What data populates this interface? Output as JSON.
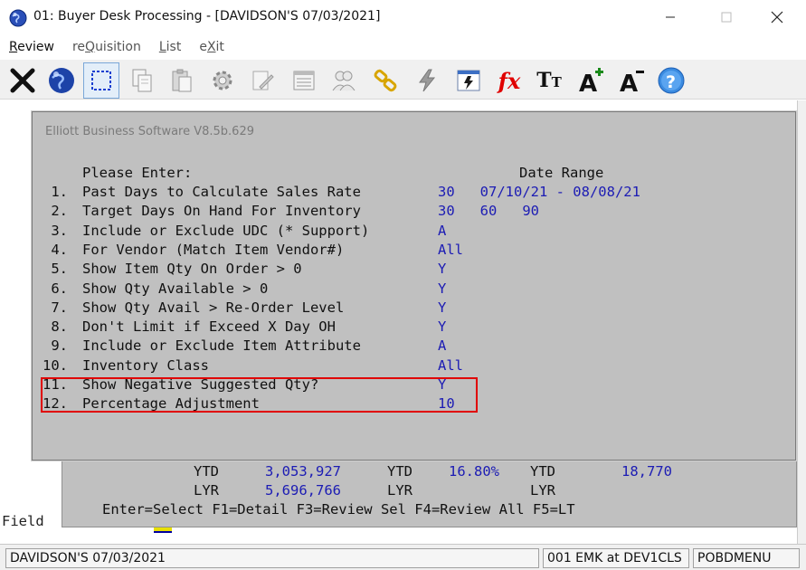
{
  "window": {
    "title": "01: Buyer Desk Processing - [DAVIDSON'S 07/03/2021]",
    "minimize_glyph": "—",
    "maximize_glyph": "☐",
    "close_glyph": "✕"
  },
  "menu": {
    "items": [
      {
        "label": "Review",
        "underline": "R",
        "rest": "eview"
      },
      {
        "label": "reQuisition",
        "pre": "re",
        "underline": "Q",
        "rest": "uisition"
      },
      {
        "label": "List",
        "underline": "L",
        "rest": "ist"
      },
      {
        "label": "eXit",
        "pre": "e",
        "underline": "X",
        "rest": "it"
      }
    ]
  },
  "toolbar": {
    "icons": [
      "close-x-icon",
      "globe-icon",
      "select-rect-icon",
      "copy-icon",
      "paste-icon",
      "settings-gear-icon",
      "edit-icon",
      "list-icon",
      "users-icon",
      "link-icon",
      "lightning-icon",
      "spreadsheet-icon",
      "fx-function-icon",
      "font-size-icon",
      "font-increase-icon",
      "font-decrease-icon",
      "help-icon"
    ],
    "fx_label": "fx",
    "help_label": "?"
  },
  "dialog": {
    "title": "Elliott Business Software V8.5b.629",
    "heading": "Please Enter:",
    "date_range_header": "Date Range",
    "rows": [
      {
        "num": " 1.",
        "label": "Past Days to Calculate Sales Rate",
        "value": "30   07/10/21 - 08/08/21"
      },
      {
        "num": " 2.",
        "label": "Target Days On Hand For Inventory",
        "value": "30   60   90"
      },
      {
        "num": " 3.",
        "label": "Include or Exclude UDC (* Support)",
        "value": "A"
      },
      {
        "num": " 4.",
        "label": "For Vendor (Match Item Vendor#)",
        "value": "All"
      },
      {
        "num": " 5.",
        "label": "Show Item Qty On Order > 0",
        "value": "Y"
      },
      {
        "num": " 6.",
        "label": "Show Qty Available > 0",
        "value": "Y"
      },
      {
        "num": " 7.",
        "label": "Show Qty Avail > Re-Order Level",
        "value": "Y"
      },
      {
        "num": " 8.",
        "label": "Don't Limit if Exceed X Day OH",
        "value": "Y"
      },
      {
        "num": " 9.",
        "label": "Include or Exclude Item Attribute",
        "value": "A"
      },
      {
        "num": "10.",
        "label": "Inventory Class",
        "value": "All"
      },
      {
        "num": "11.",
        "label": "Show Negative Suggested Qty?",
        "value": "Y"
      },
      {
        "num": "12.",
        "label": "Percentage Adjustment",
        "value": "10"
      }
    ]
  },
  "background": {
    "ytd_label": "YTD",
    "lyr_label": "LYR",
    "ytd_sales": "3,053,927",
    "lyr_sales": "5,696,766",
    "ytd_pct": "16.80%",
    "ytd_qty": "18,770",
    "function_keys": "Enter=Select F1=Detail F3=Review Sel F4=Review All F5=LT",
    "field_label": "Field"
  },
  "status": {
    "company": "DAVIDSON'S 07/03/2021",
    "user": "001 EMK at DEV1CLS",
    "program": "POBDMENU"
  },
  "colors": {
    "value_blue": "#1c1cb4",
    "highlight_red": "#e00000",
    "panel_gray": "#c0c0c0"
  }
}
